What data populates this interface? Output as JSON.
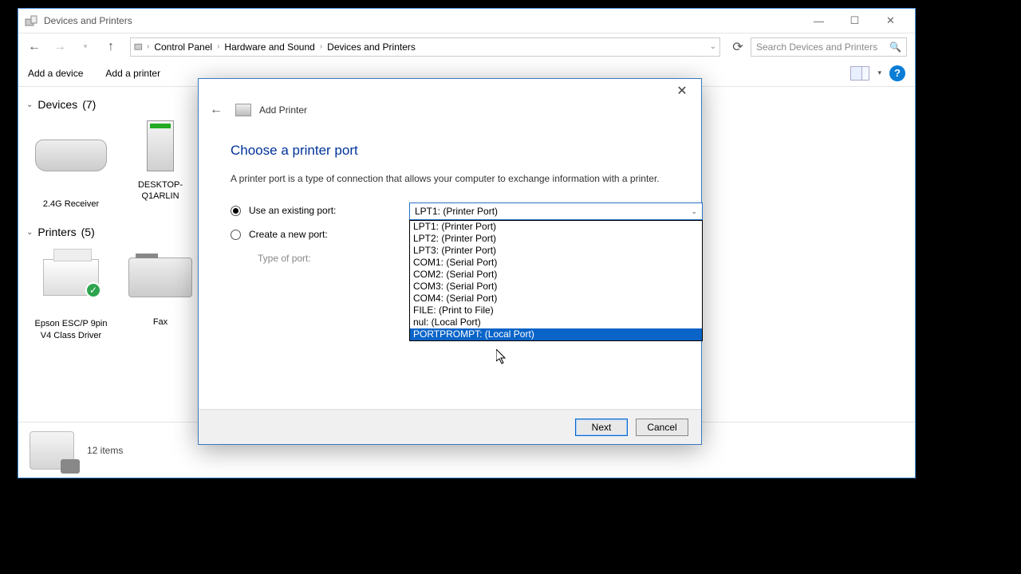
{
  "window": {
    "title": "Devices and Printers"
  },
  "breadcrumb": {
    "seg1": "Control Panel",
    "seg2": "Hardware and Sound",
    "seg3": "Devices and Printers"
  },
  "search": {
    "placeholder": "Search Devices and Printers"
  },
  "toolbar": {
    "add_device": "Add a device",
    "add_printer": "Add a printer"
  },
  "groups": {
    "devices": {
      "label": "Devices",
      "count": "(7)"
    },
    "printers": {
      "label": "Printers",
      "count": "(5)"
    }
  },
  "devices": {
    "receiver": "2.4G Receiver",
    "desktop": "DESKTOP-Q1ARLIN"
  },
  "printers": {
    "epson": "Epson ESC/P 9pin V4 Class Driver",
    "fax": "Fax"
  },
  "status": {
    "items": "12 items"
  },
  "dialog": {
    "title": "Add Printer",
    "step_title": "Choose a printer port",
    "description": "A printer port is a type of connection that allows your computer to exchange information with a printer.",
    "existing_port_label": "Use an existing port:",
    "create_port_label": "Create a new port:",
    "port_type_label": "Type of port:",
    "selected_port": "LPT1: (Printer Port)",
    "port_options": [
      "LPT1: (Printer Port)",
      "LPT2: (Printer Port)",
      "LPT3: (Printer Port)",
      "COM1: (Serial Port)",
      "COM2: (Serial Port)",
      "COM3: (Serial Port)",
      "COM4: (Serial Port)",
      "FILE: (Print to File)",
      "nul: (Local Port)",
      "PORTPROMPT: (Local Port)"
    ],
    "highlighted_option_index": 9,
    "next": "Next",
    "cancel": "Cancel"
  }
}
